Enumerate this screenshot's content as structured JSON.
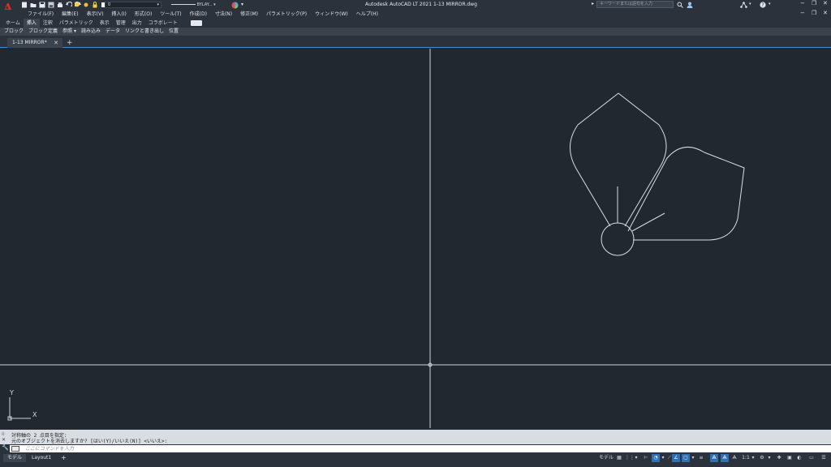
{
  "app": {
    "logo_letter": "A",
    "title": "Autodesk AutoCAD LT 2021    1-13 MIRROR.dwg",
    "search_placeholder": "キーワードまたは語句を入力",
    "layer_value": "0",
    "linetype_value": "BYLAY..."
  },
  "menu": [
    "ファイル(F)",
    "編集(E)",
    "表示(V)",
    "挿入(I)",
    "形式(O)",
    "ツール(T)",
    "作成(D)",
    "寸法(N)",
    "修正(M)",
    "パラメトリック(P)",
    "ウィンドウ(W)",
    "ヘルプ(H)"
  ],
  "ribbon_tabs": [
    "ホーム",
    "挿入",
    "注釈",
    "パラメトリック",
    "表示",
    "管理",
    "出力",
    "コラボレート"
  ],
  "ribbon_active_tab": "挿入",
  "ribbon_panels": [
    "ブロック",
    "ブロック定義",
    "参照 ▾",
    "読み込み",
    "データ",
    "リンクと書き出し",
    "位置"
  ],
  "file_tab": "1-13 MIRROR*",
  "ucs": {
    "x_label": "X",
    "y_label": "Y"
  },
  "command": {
    "history": [
      "対称軸の 2 点目を指定:",
      "元のオブジェクトを消去しますか? [はい(Y)/いいえ(N)] <いいえ>:"
    ],
    "input_placeholder": "ここにコマンドを入力"
  },
  "status": {
    "layout_tabs": [
      "モデル",
      "Layout1"
    ],
    "model_label": "モデル",
    "scale": "1:1"
  },
  "colors": {
    "background": "#212830",
    "panel": "#2b323c",
    "accent": "#3a8fd8",
    "drawing_line": "#d9dde2"
  }
}
